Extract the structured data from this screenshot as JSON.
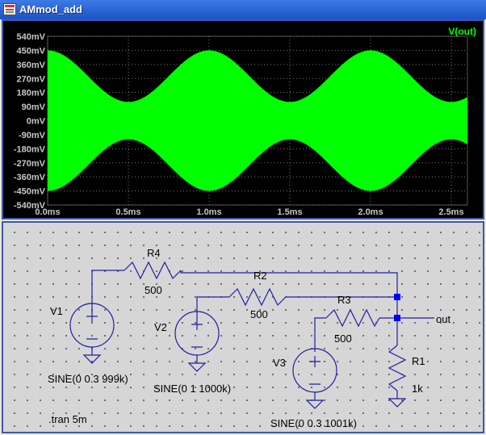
{
  "window": {
    "title": "AMmod_add",
    "icon": "ltspice-app-icon"
  },
  "waveform": {
    "trace_label": "V(out)",
    "trace_color": "#00ff00",
    "background": "#000000",
    "y_ticks": [
      "540mV",
      "450mV",
      "360mV",
      "270mV",
      "180mV",
      "90mV",
      "0mV",
      "-90mV",
      "-180mV",
      "-270mV",
      "-360mV",
      "-450mV",
      "-540mV"
    ],
    "x_ticks": [
      "0.0ms",
      "0.5ms",
      "1.0ms",
      "1.5ms",
      "2.0ms",
      "2.5ms"
    ]
  },
  "chart_data": {
    "type": "area",
    "series": [
      {
        "name": "V(out)",
        "type": "envelope",
        "envelope_max_mV": 450,
        "envelope_min_mV": 120,
        "envelope_period_ms": 1.0,
        "peak_at_ms": [
          0.0,
          1.0,
          2.0
        ]
      }
    ],
    "xlim": [
      0,
      2.6
    ],
    "ylim": [
      -540,
      540
    ],
    "xlabel": "",
    "ylabel": "",
    "grid": true
  },
  "schematic": {
    "components": [
      {
        "ref": "R4",
        "value": "500"
      },
      {
        "ref": "R2",
        "value": "500"
      },
      {
        "ref": "R3",
        "value": "500"
      },
      {
        "ref": "R1",
        "value": "1k"
      },
      {
        "ref": "V1",
        "value": "SINE(0 0.3 999k)"
      },
      {
        "ref": "V2",
        "value": "SINE(0 1 1000k)"
      },
      {
        "ref": "V3",
        "value": "SINE(0 0.3 1001k)"
      }
    ],
    "net_label": "out",
    "directive": ".tran 5m"
  }
}
